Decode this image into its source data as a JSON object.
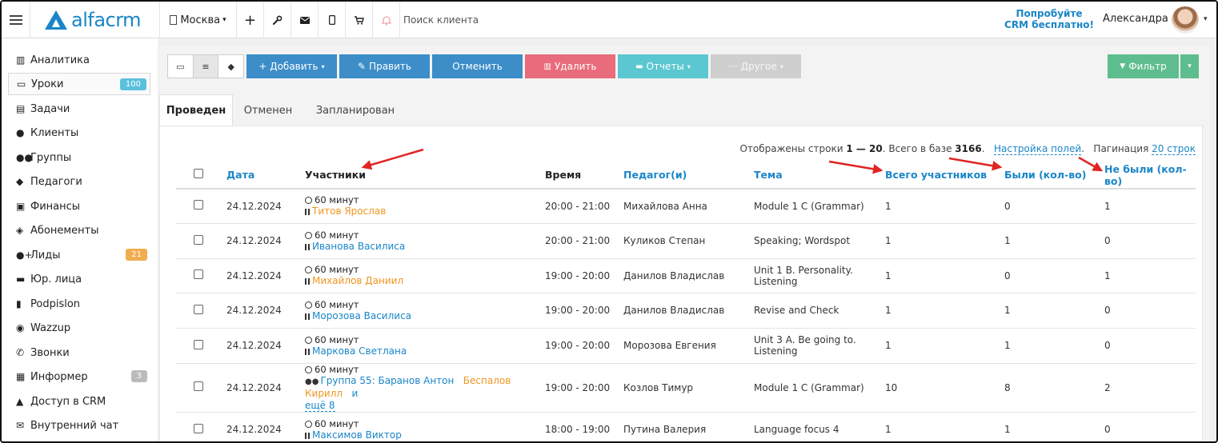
{
  "topbar": {
    "brand": "alfacrm",
    "city": "Москва",
    "search_placeholder": "Поиск клиента",
    "promo_line1": "Попробуйте",
    "promo_line2": "CRM бесплатно!",
    "user_name": "Александра",
    "icons": [
      "menu-icon",
      "plus-icon",
      "wrench-icon",
      "mail-icon",
      "phone-icon",
      "cart-icon",
      "bell-icon"
    ]
  },
  "sidebar": {
    "items": [
      {
        "label": "Аналитика",
        "icon": "book-icon"
      },
      {
        "label": "Уроки",
        "icon": "calendar-icon",
        "badge": "100"
      },
      {
        "label": "Задачи",
        "icon": "clipboard-icon"
      },
      {
        "label": "Клиенты",
        "icon": "user-icon"
      },
      {
        "label": "Группы",
        "icon": "users-icon"
      },
      {
        "label": "Педагоги",
        "icon": "graduation-cap-icon"
      },
      {
        "label": "Финансы",
        "icon": "money-icon"
      },
      {
        "label": "Абонементы",
        "icon": "tag-icon"
      },
      {
        "label": "Лиды",
        "icon": "user-plus-icon",
        "badge": "21"
      },
      {
        "label": "Юр. лица",
        "icon": "briefcase-icon"
      },
      {
        "label": "Podpislon",
        "icon": "file-icon"
      },
      {
        "label": "Wazzup",
        "icon": "whatsapp-icon"
      },
      {
        "label": "Звонки",
        "icon": "phone-icon"
      },
      {
        "label": "Информер",
        "icon": "list-icon",
        "badge": "3"
      },
      {
        "label": "Доступ в CRM",
        "icon": "lock-icon"
      },
      {
        "label": "Внутренний чат",
        "icon": "envelope-icon"
      }
    ]
  },
  "toolbar": {
    "add": "+ Добавить",
    "edit": "Править",
    "cancel": "Отменить",
    "delete": "Удалить",
    "reports": "Отчеты",
    "other": "Другое",
    "filter": "Фильтр"
  },
  "tabs": [
    "Проведен",
    "Отменен",
    "Запланирован"
  ],
  "info": {
    "prefix": "Отображены строки ",
    "range": "1 — 20",
    "middle": ". Всего в базе ",
    "total": "3166",
    "dot": ".",
    "settings_link": "Настройка полей",
    "pagination_label": "Пагинация ",
    "pagination_link": "20 строк"
  },
  "table": {
    "headers": {
      "date": "Дата",
      "participants": "Участники",
      "time": "Время",
      "teacher": "Педагог(и)",
      "topic": "Тема",
      "total": "Всего участников",
      "present": "Были (кол-во)",
      "absent": "Не были (кол-во)"
    },
    "rows": [
      {
        "date": "24.12.2024",
        "duration": "60 минут",
        "student": "Титов Ярослав",
        "student_color": "orange",
        "time": "20:00 - 21:00",
        "teacher": "Михайлова Анна",
        "topic": "Module 1 C (Grammar)",
        "total": "1",
        "present": "0",
        "absent": "1"
      },
      {
        "date": "24.12.2024",
        "duration": "60 минут",
        "student": "Иванова Василиса",
        "student_color": "blue",
        "time": "20:00 - 21:00",
        "teacher": "Куликов Степан",
        "topic": "Speaking; Wordspot",
        "total": "1",
        "present": "1",
        "absent": "0"
      },
      {
        "date": "24.12.2024",
        "duration": "60 минут",
        "student": "Михайлов Даниил",
        "student_color": "orange",
        "time": "19:00 - 20:00",
        "teacher": "Данилов Владислав",
        "topic": "Unit 1 B. Personality. Listening",
        "total": "1",
        "present": "0",
        "absent": "1"
      },
      {
        "date": "24.12.2024",
        "duration": "60 минут",
        "student": "Морозова Василиса",
        "student_color": "blue",
        "time": "19:00 - 20:00",
        "teacher": "Данилов Владислав",
        "topic": "Revise and Check",
        "total": "1",
        "present": "1",
        "absent": "0"
      },
      {
        "date": "24.12.2024",
        "duration": "60 минут",
        "student": "Маркова Светлана",
        "student_color": "blue",
        "time": "19:00 - 20:00",
        "teacher": "Морозова Евгения",
        "topic": "Unit 3 A. Be going to. Listening",
        "total": "1",
        "present": "1",
        "absent": "0"
      },
      {
        "date": "24.12.2024",
        "duration": "60 минут",
        "group_name": "Группа 55: Баранов Антон",
        "group_extra": "Беспалов Кирилл",
        "group_more_prefix": "и",
        "group_more": "ещё 8",
        "time": "19:00 - 20:00",
        "teacher": "Козлов Тимур",
        "topic": "Module 1 C (Grammar)",
        "total": "10",
        "present": "8",
        "absent": "2"
      },
      {
        "date": "24.12.2024",
        "duration": "60 минут",
        "student": "Максимов Виктор",
        "student_color": "blue",
        "time": "18:00 - 19:00",
        "teacher": "Путина Валерия",
        "topic": "Language focus 4",
        "total": "1",
        "present": "1",
        "absent": "0"
      }
    ]
  },
  "colors": {
    "accent": "#1a86c8",
    "danger": "#e86c7b",
    "info": "#5bc7d0",
    "success": "#5ebd8e",
    "warning_text": "#f0961f",
    "annotation_arrow": "#e02424"
  }
}
